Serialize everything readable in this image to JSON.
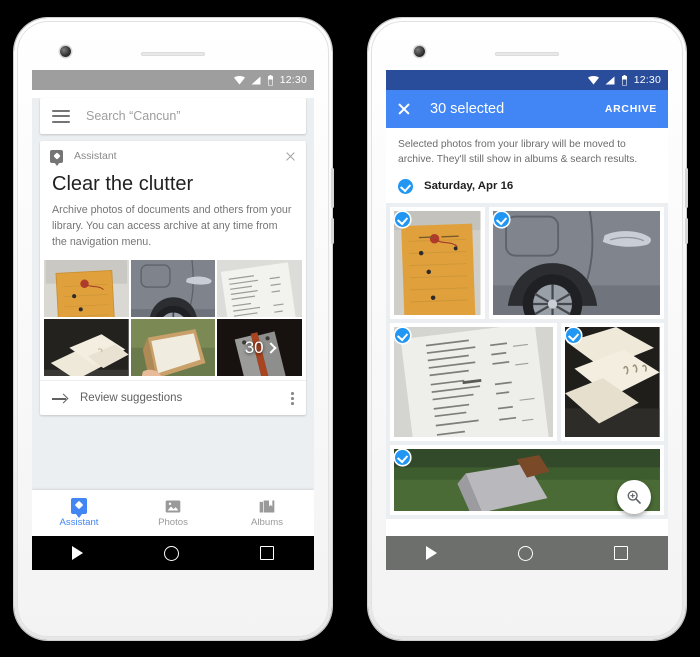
{
  "meta": {
    "app": "Google Photos",
    "platform": "Android",
    "background_color": "#000000",
    "accent_blue": "#4285f4",
    "status_blue": "#2a4d9b",
    "status_grey": "#9e9e9e"
  },
  "left_phone": {
    "status_bar": {
      "time": "12:30",
      "icons": [
        "wifi-icon",
        "signal-icon",
        "battery-icon"
      ],
      "background": "#9e9e9e"
    },
    "search": {
      "menu_icon": "hamburger-menu-icon",
      "placeholder": "Search “Cancun”"
    },
    "card": {
      "badge_icon": "assistant-icon",
      "source_label": "Assistant",
      "dismiss_icon": "close-icon",
      "title": "Clear the clutter",
      "description": "Archive photos of documents and others from your library. You can access archive at any time from the navigation menu.",
      "photos": [
        {
          "name": "manila-envelope",
          "alt": "Orange manila envelope with red string"
        },
        {
          "name": "car-wheel",
          "alt": "Grey car door and wheel"
        },
        {
          "name": "receipt-white",
          "alt": "White paper receipt"
        },
        {
          "name": "cream-envelopes",
          "alt": "Cream envelopes on dark table"
        },
        {
          "name": "cardboard-box",
          "alt": "Hand holding cardboard box"
        },
        {
          "name": "tags-dark",
          "alt": "Price tags on dark background"
        }
      ],
      "more_count": "30",
      "more_chevron": "chevron-right-icon",
      "action": {
        "icon": "arrow-right-icon",
        "label": "Review suggestions",
        "overflow_icon": "more-vert-icon"
      }
    },
    "bottom_nav": [
      {
        "label": "Assistant",
        "icon": "assistant-icon",
        "active": true
      },
      {
        "label": "Photos",
        "icon": "photos-icon",
        "active": false
      },
      {
        "label": "Albums",
        "icon": "albums-icon",
        "active": false
      }
    ],
    "system_nav": [
      {
        "name": "back-button",
        "icon": "triangle-back-icon"
      },
      {
        "name": "home-button",
        "icon": "circle-home-icon"
      },
      {
        "name": "recents-button",
        "icon": "square-recents-icon"
      }
    ]
  },
  "right_phone": {
    "status_bar": {
      "time": "12:30",
      "icons": [
        "wifi-icon",
        "signal-icon",
        "battery-icon"
      ],
      "background": "#2a4d9b"
    },
    "app_bar": {
      "close_icon": "close-icon",
      "title": "30 selected",
      "action_label": "ARCHIVE",
      "background": "#4285f4"
    },
    "notice": "Selected photos from your library will be moved to archive. They'll still show in albums & search results.",
    "day_header": {
      "checkbox_icon": "check-circle-icon",
      "label": "Saturday, Apr 16",
      "selected": true
    },
    "grid": [
      {
        "name": "manila-envelope",
        "selected": true
      },
      {
        "name": "car-wheel",
        "selected": true
      },
      {
        "name": "receipt-white",
        "selected": true
      },
      {
        "name": "hello-envelopes",
        "selected": true
      },
      {
        "name": "green-table-box",
        "selected": true
      }
    ],
    "fab": {
      "icon": "zoom-in-icon"
    },
    "system_nav": [
      {
        "name": "back-button",
        "icon": "triangle-back-icon"
      },
      {
        "name": "home-button",
        "icon": "circle-home-icon"
      },
      {
        "name": "recents-button",
        "icon": "square-recents-icon"
      }
    ]
  }
}
